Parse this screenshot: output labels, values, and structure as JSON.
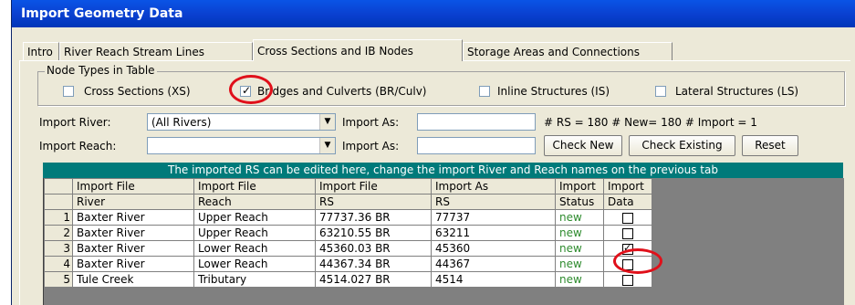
{
  "window": {
    "title": "Import Geometry Data"
  },
  "tabs": [
    {
      "label": "Intro"
    },
    {
      "label": "River Reach Stream Lines"
    },
    {
      "label": "Cross Sections and IB Nodes"
    },
    {
      "label": "Storage Areas and Connections"
    }
  ],
  "node_types": {
    "legend": "Node Types in Table",
    "options": [
      {
        "label": "Cross Sections (XS)",
        "checked": false
      },
      {
        "label": "Bridges and Culverts (BR/Culv)",
        "checked": true
      },
      {
        "label": "Inline Structures (IS)",
        "checked": false
      },
      {
        "label": "Lateral Structures (LS)",
        "checked": false
      }
    ]
  },
  "import_river": {
    "label": "Import River:",
    "value": "(All Rivers)",
    "as_label": "Import As:",
    "as_value": ""
  },
  "import_reach": {
    "label": "Import Reach:",
    "value": "",
    "as_label": "Import As:",
    "as_value": ""
  },
  "counts": "# RS = 180  # New= 180  # Import = 1",
  "buttons": {
    "check_new": "Check New",
    "check_existing": "Check Existing",
    "reset": "Reset"
  },
  "banner": "The imported RS can be edited here, change the import River and Reach names on the previous tab",
  "table": {
    "header1": [
      "Import File",
      "Import File",
      "Import File",
      "Import As",
      "Import",
      "Import"
    ],
    "header2": [
      "River",
      "Reach",
      "RS",
      "RS",
      "Status",
      "Data"
    ],
    "rows": [
      {
        "num": "1",
        "river": "Baxter River",
        "reach": "Upper Reach",
        "rs": "77737.36 BR",
        "as_rs": "77737",
        "status": "new",
        "import": false
      },
      {
        "num": "2",
        "river": "Baxter River",
        "reach": "Upper Reach",
        "rs": "63210.55 BR",
        "as_rs": "63211",
        "status": "new",
        "import": false
      },
      {
        "num": "3",
        "river": "Baxter River",
        "reach": "Lower Reach",
        "rs": "45360.03 BR",
        "as_rs": "45360",
        "status": "new",
        "import": true
      },
      {
        "num": "4",
        "river": "Baxter River",
        "reach": "Lower Reach",
        "rs": "44367.34 BR",
        "as_rs": "44367",
        "status": "new",
        "import": false
      },
      {
        "num": "5",
        "river": "Tule Creek",
        "reach": "Tributary",
        "rs": "4514.027 BR",
        "as_rs": "4514",
        "status": "new",
        "import": false
      }
    ]
  },
  "check_glyph": "✓",
  "colors": {
    "title_bar": "#0a3fcf",
    "banner": "#007a7a",
    "status_new": "#2e8b2e",
    "highlight": "#e0101a"
  }
}
